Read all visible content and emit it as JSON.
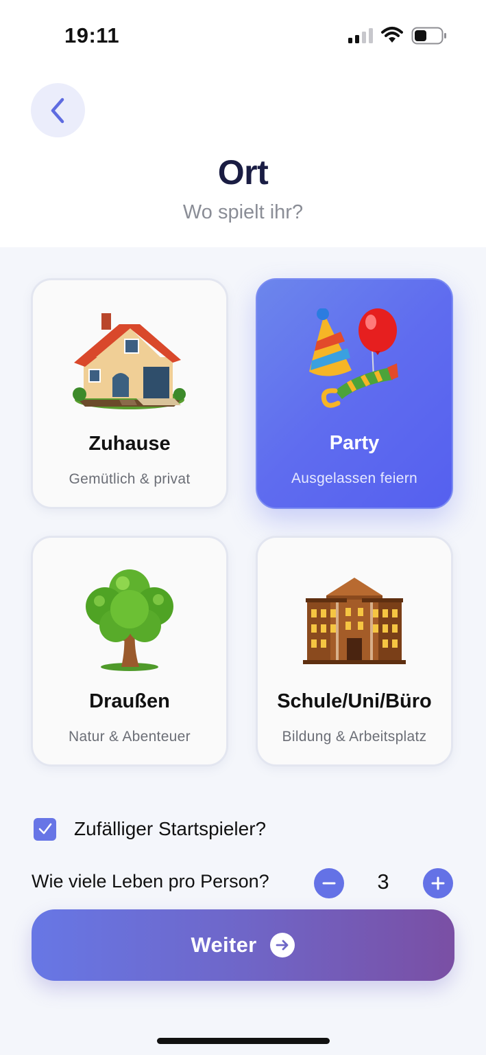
{
  "status_bar": {
    "time": "19:11"
  },
  "header": {
    "title": "Ort",
    "subtitle": "Wo spielt ihr?"
  },
  "locations": [
    {
      "title": "Zuhause",
      "subtitle": "Gemütlich & privat",
      "icon": "house-icon",
      "selected": false
    },
    {
      "title": "Party",
      "subtitle": "Ausgelassen feiern",
      "icon": "party-icon",
      "selected": true
    },
    {
      "title": "Draußen",
      "subtitle": "Natur & Abenteuer",
      "icon": "tree-icon",
      "selected": false
    },
    {
      "title": "Schule/Uni/Büro",
      "subtitle": "Bildung & Arbeitsplatz",
      "icon": "building-icon",
      "selected": false
    }
  ],
  "random_start": {
    "label": "Zufälliger Startspieler?",
    "checked": true
  },
  "lives": {
    "label": "Wie viele Leben pro Person?",
    "value": "3"
  },
  "continue_button": {
    "label": "Weiter"
  },
  "colors": {
    "accent": "#5f6cef",
    "gradient_start": "#6777e5",
    "gradient_end": "#7a4fa4"
  }
}
